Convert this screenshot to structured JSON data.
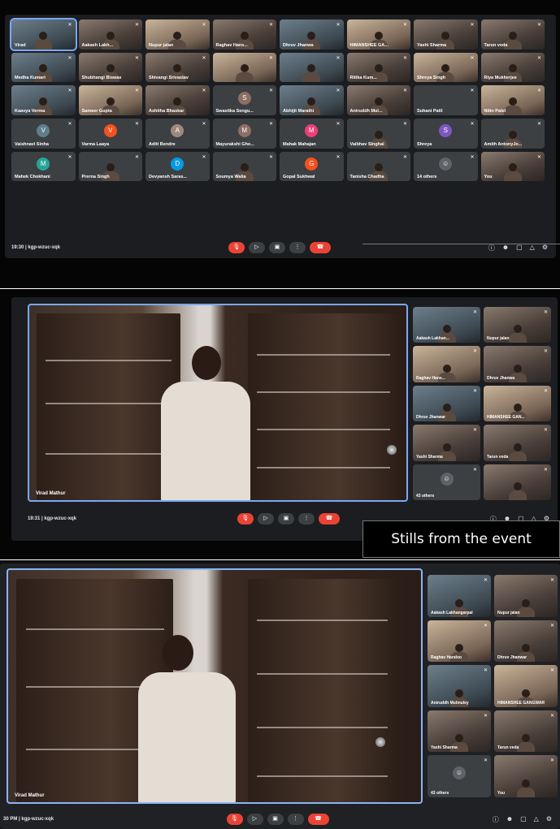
{
  "caption": "Stills from the event",
  "panel1": {
    "tiles": [
      {
        "name": "Virad",
        "kind": "host"
      },
      {
        "name": "Aakash Lakh...",
        "kind": "video"
      },
      {
        "name": "Nupur jalan",
        "kind": "video"
      },
      {
        "name": "Raghav Hans...",
        "kind": "video"
      },
      {
        "name": "Dhruv Jhanwa",
        "kind": "video"
      },
      {
        "name": "HIMANSHEE GA...",
        "kind": "video"
      },
      {
        "name": "Yashi Sharma",
        "kind": "video"
      },
      {
        "name": "Tarun veda",
        "kind": "video"
      },
      {
        "name": "Medha Kumari",
        "kind": "video"
      },
      {
        "name": "Shubhangi Biswas",
        "kind": "video"
      },
      {
        "name": "Shivangi Srivastav",
        "kind": "video"
      },
      {
        "name": "",
        "kind": "video"
      },
      {
        "name": "",
        "kind": "video"
      },
      {
        "name": "Ritika Kum...",
        "kind": "video"
      },
      {
        "name": "Shreya Singh",
        "kind": "video"
      },
      {
        "name": "Riya Mukherjee",
        "kind": "video"
      },
      {
        "name": "Kaavya Verma",
        "kind": "video"
      },
      {
        "name": "Sameer Gupta",
        "kind": "video"
      },
      {
        "name": "Ashitha Bhaskar",
        "kind": "video"
      },
      {
        "name": "Swastika Sengu...",
        "kind": "avatar",
        "letter": "S",
        "color": "#8d6e63"
      },
      {
        "name": "Abhijit Marathi",
        "kind": "video"
      },
      {
        "name": "Aniruddh Mul...",
        "kind": "video"
      },
      {
        "name": "Suhani Patil",
        "kind": "dark"
      },
      {
        "name": "Nitin Patel",
        "kind": "video"
      },
      {
        "name": "Vaishnavi Sinha",
        "kind": "avatar",
        "letter": "V",
        "color": "#607d8b"
      },
      {
        "name": "Varma Laaya",
        "kind": "avatar",
        "letter": "V",
        "color": "#f4511e"
      },
      {
        "name": "Aditi Bendre",
        "kind": "avatar",
        "letter": "A",
        "color": "#a1887f"
      },
      {
        "name": "Mayurakshi Gho...",
        "kind": "avatar",
        "letter": "M",
        "color": "#8d6e63"
      },
      {
        "name": "Mahak Mahajan",
        "kind": "avatar",
        "letter": "M",
        "color": "#ec407a"
      },
      {
        "name": "Vaibhav Singhal",
        "kind": "photo"
      },
      {
        "name": "Shreya",
        "kind": "avatar",
        "letter": "S",
        "color": "#7e57c2"
      },
      {
        "name": "Amith AntonyJo...",
        "kind": "photo"
      },
      {
        "name": "Mahek Chokhani",
        "kind": "avatar",
        "letter": "M",
        "color": "#26a69a"
      },
      {
        "name": "Prerna Singh",
        "kind": "photo"
      },
      {
        "name": "Devyansh Saras...",
        "kind": "avatar",
        "letter": "D",
        "color": "#039be5"
      },
      {
        "name": "Soumya Walia",
        "kind": "photo"
      },
      {
        "name": "Gopal Sukhwal",
        "kind": "avatar",
        "letter": "G",
        "color": "#f4511e"
      },
      {
        "name": "Tanisha Chadha",
        "kind": "photo"
      },
      {
        "name": "14 others",
        "kind": "others"
      },
      {
        "name": "You",
        "kind": "video"
      }
    ],
    "time_code": "19:30 | kgp-wzuc-xqk"
  },
  "panel2": {
    "speaker": "Virad Mathur",
    "time_code": "19:31 | kgp-wzuc-xqk",
    "side_tiles": [
      "Aakash Lakhan...",
      "Nupur jalan",
      "Raghav Hans...",
      "Dhruv Jhanwa",
      "Dhruv Jhanwar",
      "HIMANSHEE GAN...",
      "Yashi Sharma",
      "Tarun veda",
      "43 others",
      ""
    ]
  },
  "panel3": {
    "speaker": "Virad Mathur",
    "time_code": "30 PM | kgp-wzuc-xqk",
    "side_tiles": [
      "Aakash Lakhangarpal",
      "Nupur jalan",
      "Raghav Handoo",
      "Dhruv Jhanwar",
      "Aniruddh Mulmuley",
      "HIMANSHEE GANGWAR",
      "Yashi Sharma",
      "Tarun veda",
      "43 others",
      "You"
    ]
  },
  "controls": {
    "mic_icon": "mic-off-icon",
    "cam_icon": "camera-icon",
    "present_icon": "present-icon",
    "more_icon": "more-icon",
    "end_icon": "end-call-icon"
  }
}
